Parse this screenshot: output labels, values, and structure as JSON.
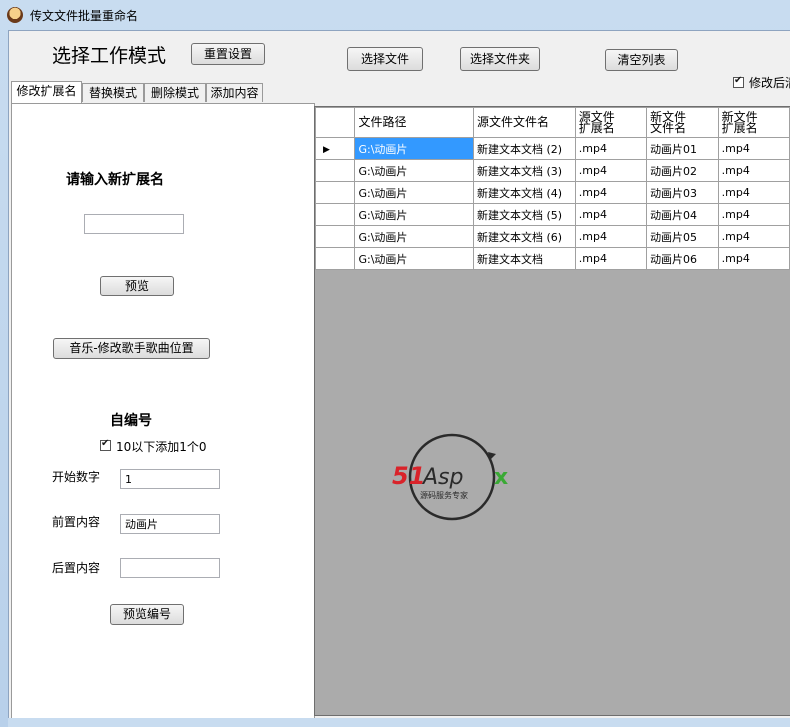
{
  "window": {
    "title": "传文文件批量重命名"
  },
  "header": {
    "mode_title": "选择工作模式",
    "reset_button": "重置设置",
    "select_file_button": "选择文件",
    "select_folder_button": "选择文件夹",
    "clear_list_button": "清空列表",
    "modify_after_checkbox_label": "修改后清"
  },
  "tabs": [
    {
      "label": "修改扩展名",
      "active": true
    },
    {
      "label": "替换模式"
    },
    {
      "label": "删除模式"
    },
    {
      "label": "添加内容"
    }
  ],
  "extension_panel": {
    "heading": "请输入新扩展名",
    "extension_input_value": "",
    "preview_button": "预览",
    "music_button": "音乐-修改歌手歌曲位置"
  },
  "numbering_panel": {
    "heading": "自编号",
    "pad_checkbox_label": "10以下添加1个0",
    "start_label": "开始数字",
    "start_value": "1",
    "prefix_label": "前置内容",
    "prefix_value": "动画片",
    "suffix_label": "后置内容",
    "suffix_value": "",
    "preview_number_button": "预览编号"
  },
  "grid": {
    "headers": [
      "文件路径",
      "源文件文件名",
      "源文件\n扩展名",
      "新文件\n文件名",
      "新文件\n扩展名"
    ],
    "rows": [
      [
        "G:\\动画片",
        "新建文本文档 (2)",
        ".mp4",
        "动画片01",
        ".mp4"
      ],
      [
        "G:\\动画片",
        "新建文本文档 (3)",
        ".mp4",
        "动画片02",
        ".mp4"
      ],
      [
        "G:\\动画片",
        "新建文本文档 (4)",
        ".mp4",
        "动画片03",
        ".mp4"
      ],
      [
        "G:\\动画片",
        "新建文本文档 (5)",
        ".mp4",
        "动画片04",
        ".mp4"
      ],
      [
        "G:\\动画片",
        "新建文本文档 (6)",
        ".mp4",
        "动画片05",
        ".mp4"
      ],
      [
        "G:\\动画片",
        "新建文本文档",
        ".mp4",
        "动画片06",
        ".mp4"
      ]
    ]
  },
  "watermark": {
    "brand": "51Aspx",
    "tagline": "源码服务专家"
  },
  "colors": {
    "selection": "#3399ff",
    "grid_bg": "#ababab",
    "logo_red": "#d9232a",
    "logo_green": "#3aa935"
  }
}
